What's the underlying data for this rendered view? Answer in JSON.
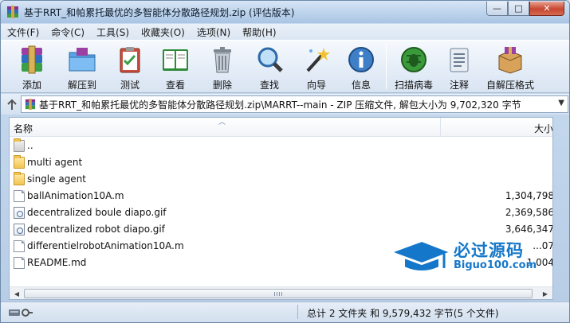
{
  "window": {
    "title": "基于RRT_和帕累托最优的多智能体分散路径规划.zip (评估版本)",
    "controls": {
      "minimize": "—",
      "maximize": "□",
      "close": "✕"
    }
  },
  "menu": [
    "文件(F)",
    "命令(C)",
    "工具(S)",
    "收藏夹(O)",
    "选项(N)",
    "帮助(H)"
  ],
  "toolbar": {
    "buttons": [
      {
        "id": "add",
        "label": "添加",
        "icon": "archive-add-icon"
      },
      {
        "id": "extract",
        "label": "解压到",
        "icon": "folder-extract-icon"
      },
      {
        "id": "test",
        "label": "测试",
        "icon": "clipboard-check-icon"
      },
      {
        "id": "view",
        "label": "查看",
        "icon": "book-icon"
      },
      {
        "id": "delete",
        "label": "删除",
        "icon": "trash-icon"
      },
      {
        "id": "find",
        "label": "查找",
        "icon": "magnifier-icon"
      },
      {
        "id": "wizard",
        "label": "向导",
        "icon": "wand-icon"
      },
      {
        "id": "info",
        "label": "信息",
        "icon": "info-icon"
      },
      {
        "id": "scan",
        "label": "扫描病毒",
        "icon": "bug-scan-icon"
      },
      {
        "id": "comment",
        "label": "注释",
        "icon": "notepad-icon"
      },
      {
        "id": "sfx",
        "label": "自解压格式",
        "icon": "sfx-box-icon"
      }
    ]
  },
  "address": {
    "path": "基于RRT_和帕累托最优的多智能体分散路径规划.zip\\MARRT--main - ZIP 压缩文件, 解包大小为 9,702,320 字节"
  },
  "filelist": {
    "columns": {
      "name": "名称",
      "size": "大小"
    },
    "rows": [
      {
        "name": "..",
        "size": "",
        "kind": "folder"
      },
      {
        "name": "multi agent",
        "size": "",
        "kind": "folder"
      },
      {
        "name": "single agent",
        "size": "",
        "kind": "folder"
      },
      {
        "name": "ballAnimation10A.m",
        "size": "1,304,798",
        "kind": "file"
      },
      {
        "name": "decentralized boule diapo.gif",
        "size": "2,369,586",
        "kind": "gif"
      },
      {
        "name": "decentralized robot diapo.gif",
        "size": "3,646,347",
        "kind": "gif"
      },
      {
        "name": "differentielrobotAnimation10A.m",
        "size": "...07",
        "kind": "file"
      },
      {
        "name": "README.md",
        "size": "1,004",
        "kind": "file"
      }
    ]
  },
  "status": {
    "text": "总计 2 文件夹 和 9,579,432 字节(5 个文件)"
  },
  "watermark": {
    "line1": "必过源码",
    "line2": "Biguo100.com"
  }
}
